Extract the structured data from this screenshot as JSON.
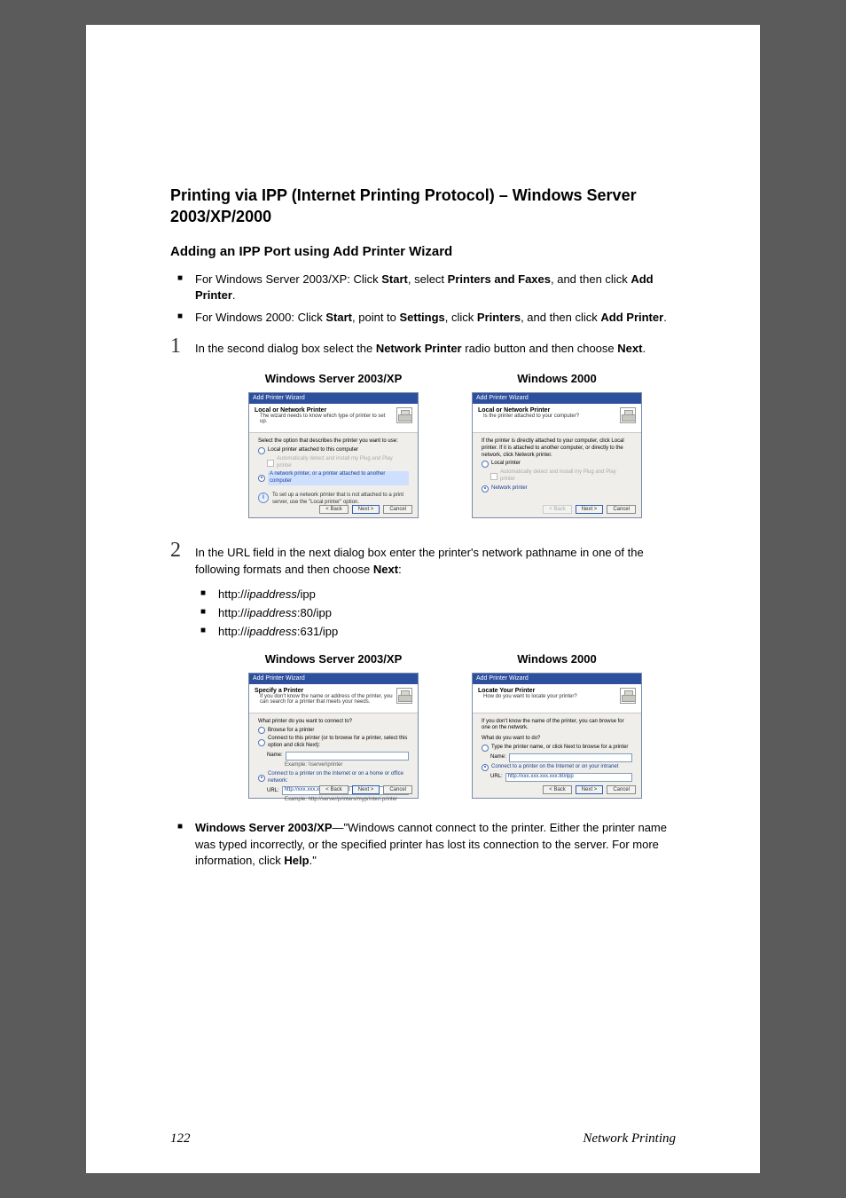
{
  "heading": "Printing via IPP (Internet Printing Protocol) – Windows Server 2003/XP/2000",
  "subheading": "Adding an IPP Port using Add Printer Wizard",
  "intro_bullets": [
    {
      "pre": "For Windows Server 2003/XP: Click ",
      "b1": "Start",
      "mid1": ", select ",
      "b2": "Printers and Faxes",
      "mid2": ", and then click ",
      "b3": "Add Printer",
      "post": "."
    },
    {
      "pre": "For Windows 2000: Click ",
      "b1": "Start",
      "mid1": ", point to ",
      "b2": "Settings",
      "mid2": ", click ",
      "b3": "Printers",
      "mid3": ", and then click ",
      "b4": "Add Printer",
      "post": "."
    }
  ],
  "step1": {
    "num": "1",
    "pre": "In the second dialog box select the ",
    "b1": "Network Printer",
    "mid": " radio button and then choose ",
    "b2": "Next",
    "post": "."
  },
  "caps": {
    "xp": "Windows Server 2003/XP",
    "w2k": "Windows 2000"
  },
  "wiz1_xp": {
    "title": "Add Printer Wizard",
    "htitle": "Local or Network Printer",
    "hsub": "The wizard needs to know which type of printer to set up.",
    "prompt": "Select the option that describes the printer you want to use:",
    "opt1": "Local printer attached to this computer",
    "chk": "Automatically detect and install my Plug and Play printer",
    "opt2": "A network printer, or a printer attached to another computer",
    "hint": "To set up a network printer that is not attached to a print server, use the \"Local printer\" option."
  },
  "wiz1_2k": {
    "title": "Add Printer Wizard",
    "htitle": "Local or Network Printer",
    "hsub": "Is the printer attached to your computer?",
    "prompt": "If the printer is directly attached to your computer, click Local printer. If it is attached to another computer, or directly to the network, click Network printer.",
    "opt1": "Local printer",
    "chk": "Automatically detect and install my Plug and Play printer",
    "opt2": "Network printer"
  },
  "step2": {
    "num": "2",
    "pre": "In the URL field in the next dialog box enter the printer's network pathname in one of the following formats and then choose ",
    "b1": "Next",
    "post": ":"
  },
  "urls": [
    {
      "p1": "http://",
      "i": "ipaddress",
      "p2": "/ipp"
    },
    {
      "p1": "http://",
      "i": "ipaddress",
      "p2": ":80/ipp"
    },
    {
      "p1": "http://",
      "i": "ipaddress",
      "p2": ":631/ipp"
    }
  ],
  "wiz2_xp": {
    "title": "Add Printer Wizard",
    "htitle": "Specify a Printer",
    "hsub": "If you don't know the name or address of the printer, you can search for a printer that meets your needs.",
    "prompt": "What printer do you want to connect to?",
    "opt1": "Browse for a printer",
    "opt2": "Connect to this printer (or to browse for a printer, select this option and click Next):",
    "name_lbl": "Name:",
    "example_lbl": "Example: \\\\server\\printer",
    "opt3": "Connect to a printer on the Internet or on a home or office network:",
    "url_lbl": "URL:",
    "url_val": "http://xxx.xxx.xxx.xxx:80/ipp",
    "example2": "Example: http://server/printers/myprinter/.printer"
  },
  "wiz2_2k": {
    "title": "Add Printer Wizard",
    "htitle": "Locate Your Printer",
    "hsub": "How do you want to locate your printer?",
    "prompt": "If you don't know the name of the printer, you can browse for one on the network.",
    "q": "What do you want to do?",
    "opt1": "Type the printer name, or click Next to browse for a printer",
    "name_lbl": "Name:",
    "opt2": "Connect to a printer on the Internet or on your intranet",
    "url_lbl": "URL:",
    "url_val": "http://xxx.xxx.xxx.xxx:80/ipp"
  },
  "btns": {
    "back": "< Back",
    "next": "Next >",
    "cancel": "Cancel"
  },
  "note": {
    "lead": "Windows Server 2003/XP",
    "dash": "—",
    "body1": "\"Windows cannot connect to the printer. Either the printer name was typed incorrectly, or the specified printer has lost its connection to the server. For more information, click ",
    "b": "Help",
    "body2": ".\""
  },
  "footer": {
    "page": "122",
    "section": "Network Printing"
  }
}
